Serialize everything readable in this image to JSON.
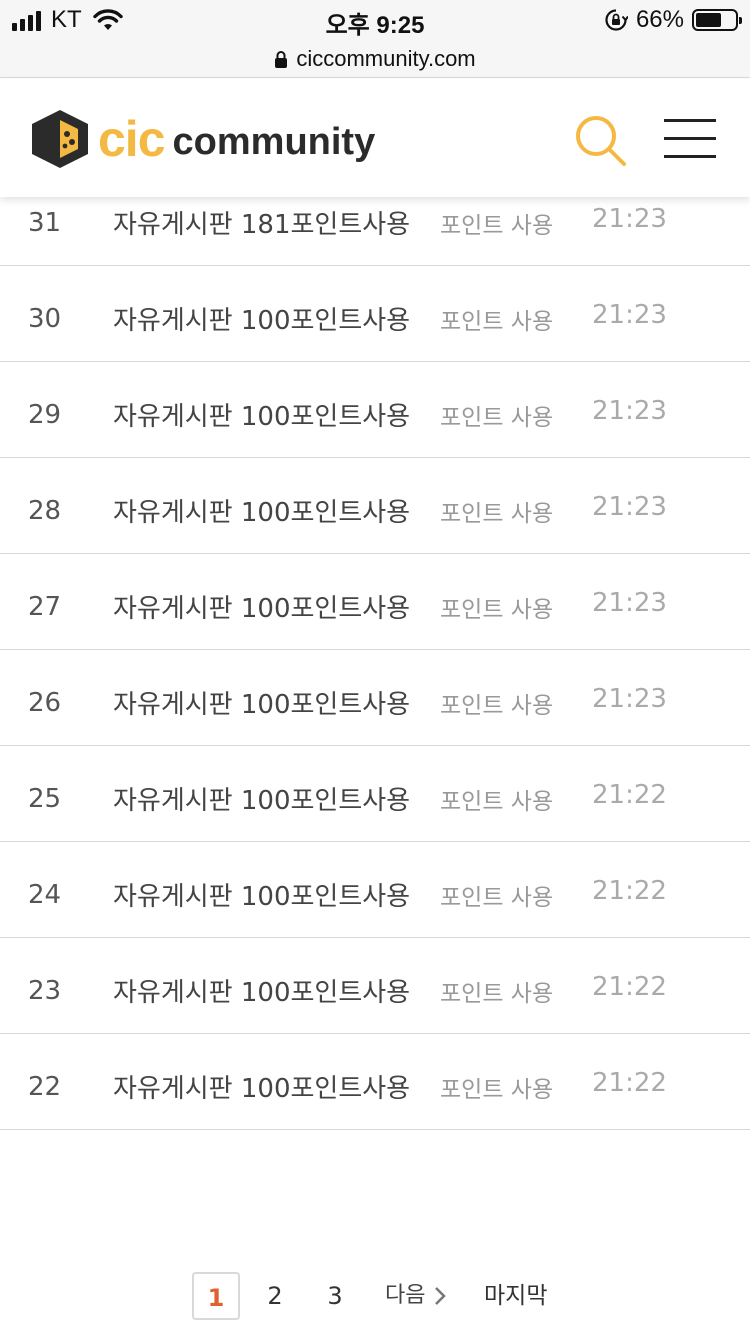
{
  "status_bar": {
    "carrier": "KT",
    "time": "오후 9:25",
    "battery_percent": "66%",
    "battery_level": 0.66
  },
  "url_bar": {
    "url": "ciccommunity.com"
  },
  "header": {
    "logo_cic": "cic",
    "logo_community": "community"
  },
  "board": {
    "rows": [
      {
        "num": "31",
        "title": "자유게시판 181포인트사용",
        "category": "포인트 사용",
        "time": "21:23"
      },
      {
        "num": "30",
        "title": "자유게시판 100포인트사용",
        "category": "포인트 사용",
        "time": "21:23"
      },
      {
        "num": "29",
        "title": "자유게시판 100포인트사용",
        "category": "포인트 사용",
        "time": "21:23"
      },
      {
        "num": "28",
        "title": "자유게시판 100포인트사용",
        "category": "포인트 사용",
        "time": "21:23"
      },
      {
        "num": "27",
        "title": "자유게시판 100포인트사용",
        "category": "포인트 사용",
        "time": "21:23"
      },
      {
        "num": "26",
        "title": "자유게시판 100포인트사용",
        "category": "포인트 사용",
        "time": "21:23"
      },
      {
        "num": "25",
        "title": "자유게시판 100포인트사용",
        "category": "포인트 사용",
        "time": "21:22"
      },
      {
        "num": "24",
        "title": "자유게시판 100포인트사용",
        "category": "포인트 사용",
        "time": "21:22"
      },
      {
        "num": "23",
        "title": "자유게시판 100포인트사용",
        "category": "포인트 사용",
        "time": "21:22"
      },
      {
        "num": "22",
        "title": "자유게시판 100포인트사용",
        "category": "포인트 사용",
        "time": "21:22"
      }
    ]
  },
  "pagination": {
    "pages": [
      "1",
      "2",
      "3"
    ],
    "current": "1",
    "next_label": "다음",
    "last_label": "마지막"
  },
  "colors": {
    "brand_yellow": "#f4b942",
    "brand_dark": "#2b2b2b",
    "current_page": "#e0602f"
  },
  "icons": {
    "search": "search-icon",
    "menu": "hamburger-menu-icon",
    "next": "chevron-right-icon"
  }
}
